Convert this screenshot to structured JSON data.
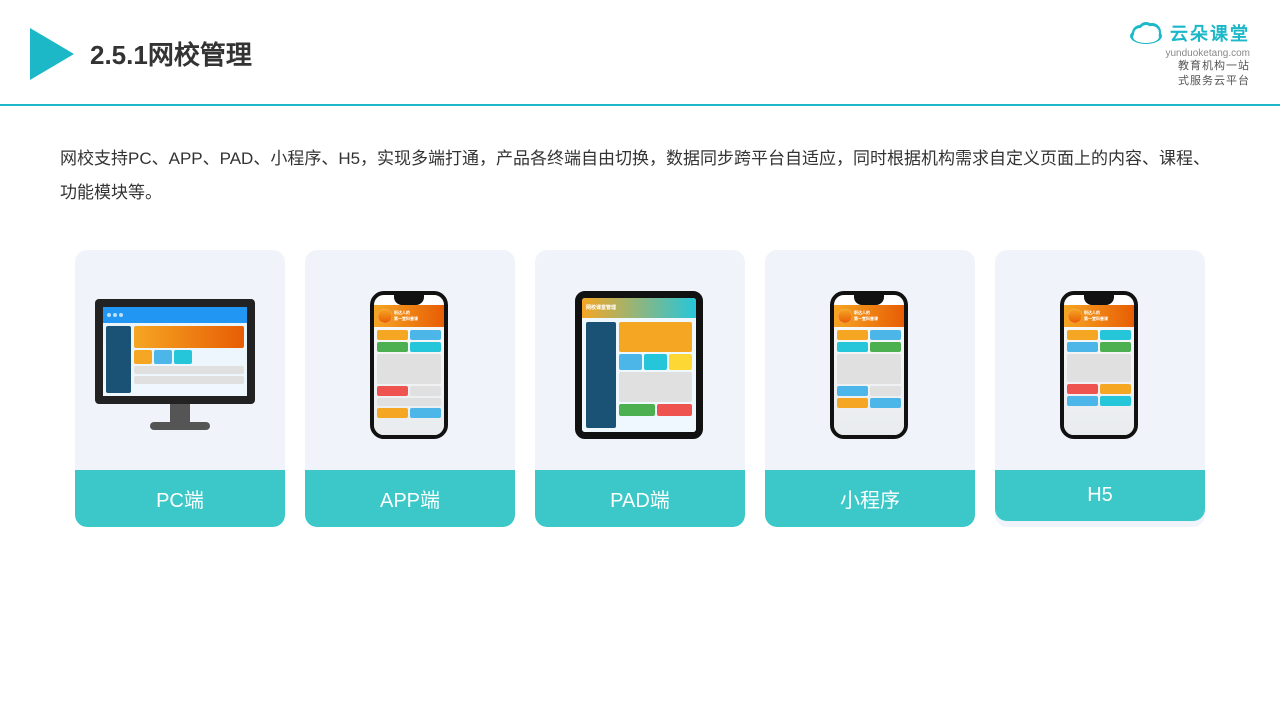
{
  "header": {
    "title": "2.5.1网校管理",
    "brand_name": "云朵课堂",
    "brand_url": "yunduoketang.com",
    "brand_tagline": "教育机构一站\n式服务云平台"
  },
  "description": {
    "text": "网校支持PC、APP、PAD、小程序、H5，实现多端打通，产品各终端自由切换，数据同步跨平台自适应，同时根据机构需求自定义页面上的内容、课程、功能模块等。"
  },
  "cards": [
    {
      "id": "pc",
      "label": "PC端"
    },
    {
      "id": "app",
      "label": "APP端"
    },
    {
      "id": "pad",
      "label": "PAD端"
    },
    {
      "id": "miniprogram",
      "label": "小程序"
    },
    {
      "id": "h5",
      "label": "H5"
    }
  ]
}
